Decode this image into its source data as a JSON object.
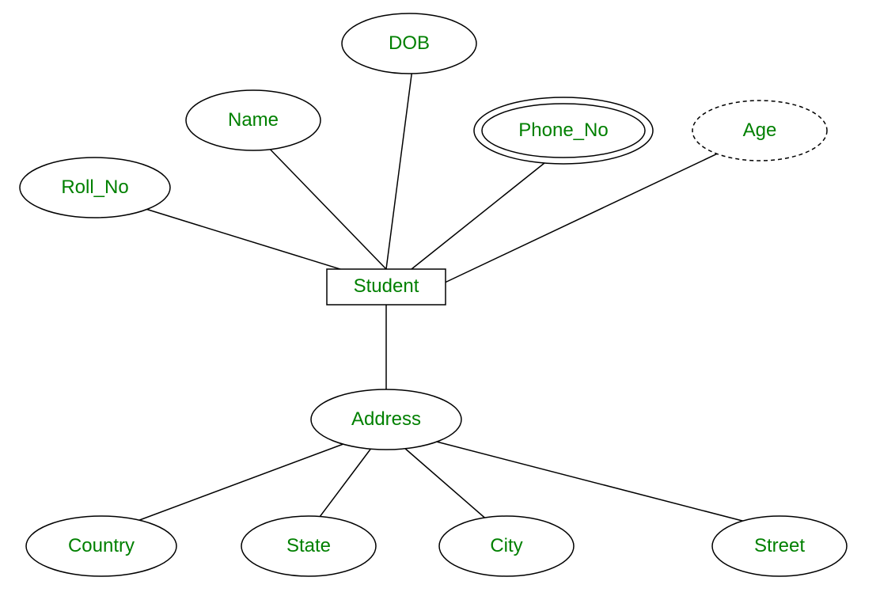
{
  "entity": {
    "name": "Student"
  },
  "attributes": {
    "roll_no": "Roll_No",
    "name": "Name",
    "dob": "DOB",
    "phone_no": "Phone_No",
    "age": "Age",
    "address": "Address"
  },
  "sub_attributes": {
    "country": "Country",
    "state": "State",
    "city": "City",
    "street": "Street"
  },
  "colors": {
    "text": "#008000",
    "stroke": "#000000"
  }
}
